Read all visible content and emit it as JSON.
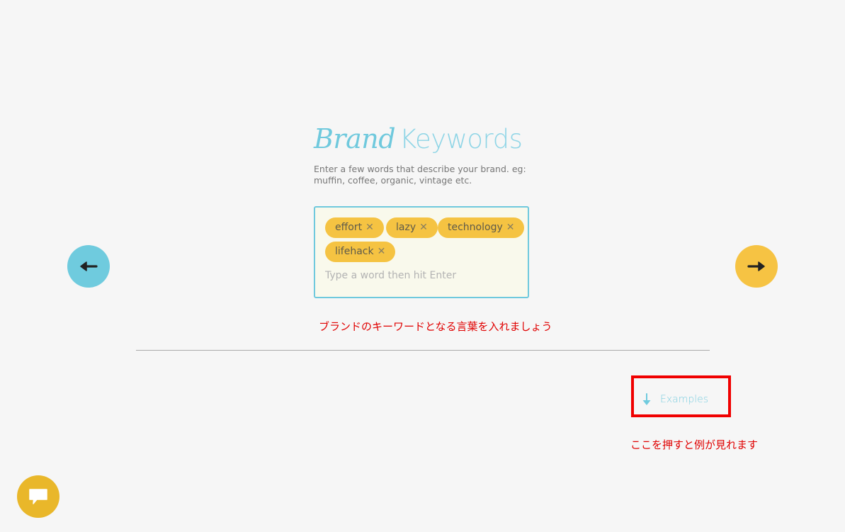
{
  "header": {
    "title_brand": "Brand",
    "title_keywords": "Keywords",
    "subtitle": "Enter a few words that describe your brand. eg: muffin, coffee, organic, vintage etc."
  },
  "tag_input": {
    "tags": [
      "effort",
      "lazy",
      "technology",
      "lifehack"
    ],
    "remove_glyph": "✕",
    "placeholder": "Type a word then hit Enter",
    "value": ""
  },
  "nav": {
    "prev_icon": "arrow-left-icon",
    "next_icon": "arrow-right-icon"
  },
  "annotations": {
    "keywords_note": "ブランドのキーワードとなる言葉を入れましょう",
    "examples_note": "ここを押すと例が見れます"
  },
  "examples": {
    "label": "Examples",
    "icon": "arrow-down-icon"
  },
  "chat": {
    "icon": "chat-bubble-icon"
  },
  "colors": {
    "accent_blue": "#6fcbde",
    "accent_yellow": "#f6c343",
    "annotation_red": "#e00000"
  }
}
